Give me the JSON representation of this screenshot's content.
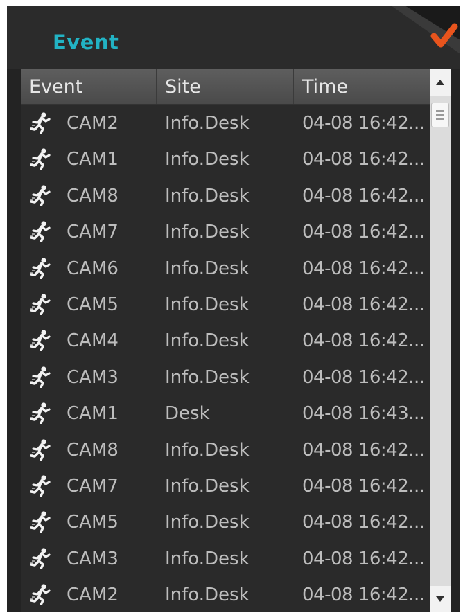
{
  "panel": {
    "title": "Event",
    "corner_icon": "checkmark-icon",
    "accent_color": "#22b3c4",
    "check_color": "#e8541d"
  },
  "table": {
    "columns": [
      "Event",
      "Site",
      "Time"
    ],
    "row_icon": "running-person-icon",
    "rows": [
      {
        "cam": "CAM2",
        "site": "Info.Desk",
        "time": "04-08 16:42..."
      },
      {
        "cam": "CAM1",
        "site": "Info.Desk",
        "time": "04-08 16:42..."
      },
      {
        "cam": "CAM8",
        "site": "Info.Desk",
        "time": "04-08 16:42..."
      },
      {
        "cam": "CAM7",
        "site": "Info.Desk",
        "time": "04-08 16:42..."
      },
      {
        "cam": "CAM6",
        "site": "Info.Desk",
        "time": "04-08 16:42..."
      },
      {
        "cam": "CAM5",
        "site": "Info.Desk",
        "time": "04-08 16:42..."
      },
      {
        "cam": "CAM4",
        "site": "Info.Desk",
        "time": "04-08 16:42..."
      },
      {
        "cam": "CAM3",
        "site": "Info.Desk",
        "time": "04-08 16:42..."
      },
      {
        "cam": "CAM1",
        "site": "Desk",
        "time": "04-08 16:43..."
      },
      {
        "cam": "CAM8",
        "site": "Info.Desk",
        "time": "04-08 16:42..."
      },
      {
        "cam": "CAM7",
        "site": "Info.Desk",
        "time": "04-08 16:42..."
      },
      {
        "cam": "CAM5",
        "site": "Info.Desk",
        "time": "04-08 16:42..."
      },
      {
        "cam": "CAM3",
        "site": "Info.Desk",
        "time": "04-08 16:42..."
      },
      {
        "cam": "CAM2",
        "site": "Info.Desk",
        "time": "04-08 16:42..."
      }
    ]
  },
  "scrollbar": {
    "up_icon": "arrow-up-icon",
    "down_icon": "arrow-down-icon"
  }
}
